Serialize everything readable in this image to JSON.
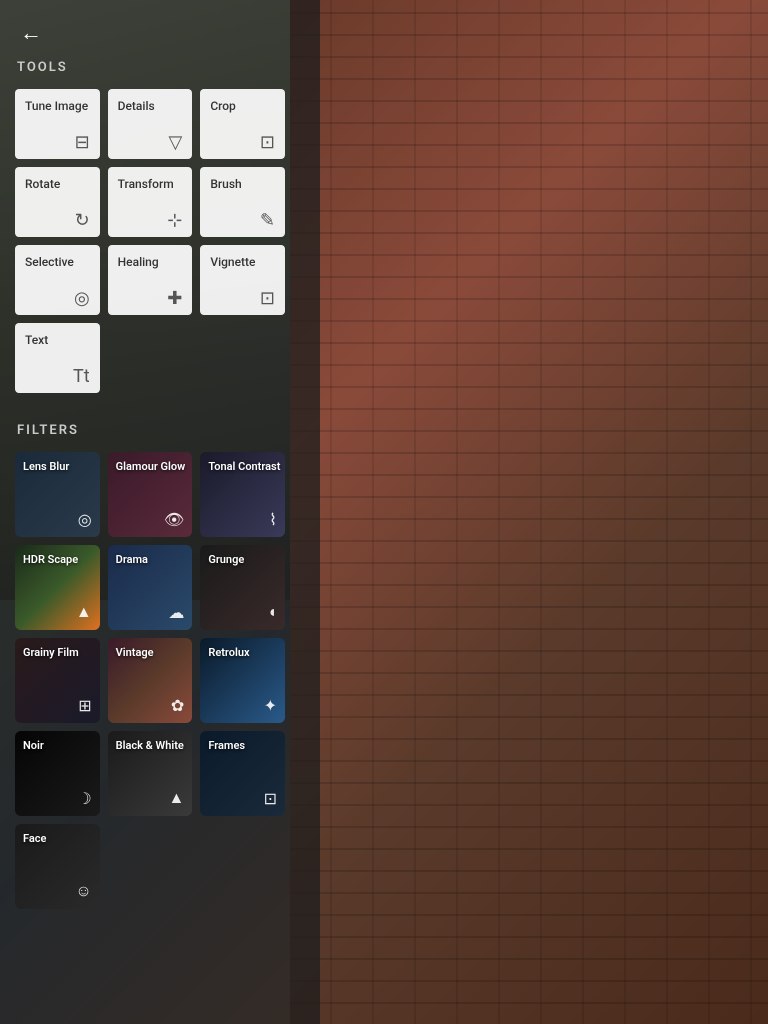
{
  "header": {
    "back_label": "←"
  },
  "tools_section": {
    "title": "TOOLS",
    "items": [
      {
        "id": "tune-image",
        "name": "Tune Image",
        "icon": "⊟"
      },
      {
        "id": "details",
        "name": "Details",
        "icon": "▽"
      },
      {
        "id": "crop",
        "name": "Crop",
        "icon": "⊡"
      },
      {
        "id": "rotate",
        "name": "Rotate",
        "icon": "↻"
      },
      {
        "id": "transform",
        "name": "Transform",
        "icon": "⊹"
      },
      {
        "id": "brush",
        "name": "Brush",
        "icon": "✎"
      },
      {
        "id": "selective",
        "name": "Selective",
        "icon": "◎"
      },
      {
        "id": "healing",
        "name": "Healing",
        "icon": "✚"
      },
      {
        "id": "vignette",
        "name": "Vignette",
        "icon": "⊡"
      },
      {
        "id": "text",
        "name": "Text",
        "icon": "Tt"
      }
    ]
  },
  "filters_section": {
    "title": "FILTERS",
    "items": [
      {
        "id": "lens-blur",
        "name": "Lens Blur",
        "icon": "◎"
      },
      {
        "id": "glamour-glow",
        "name": "Glamour Glow",
        "icon": "👁"
      },
      {
        "id": "tonal-contrast",
        "name": "Tonal Contrast",
        "icon": "⌇"
      },
      {
        "id": "hdr-scape",
        "name": "HDR Scape",
        "icon": "▲"
      },
      {
        "id": "drama",
        "name": "Drama",
        "icon": "☁"
      },
      {
        "id": "grunge",
        "name": "Grunge",
        "icon": "◖"
      },
      {
        "id": "grainy-film",
        "name": "Grainy Film",
        "icon": "⊞"
      },
      {
        "id": "vintage",
        "name": "Vintage",
        "icon": "✿"
      },
      {
        "id": "retrolux",
        "name": "Retrolux",
        "icon": "✦"
      },
      {
        "id": "noir",
        "name": "Noir",
        "icon": "☽"
      },
      {
        "id": "black-white",
        "name": "Black & White",
        "icon": "▲"
      },
      {
        "id": "frames",
        "name": "Frames",
        "icon": "⊡"
      },
      {
        "id": "face",
        "name": "Face",
        "icon": "☺"
      }
    ]
  }
}
